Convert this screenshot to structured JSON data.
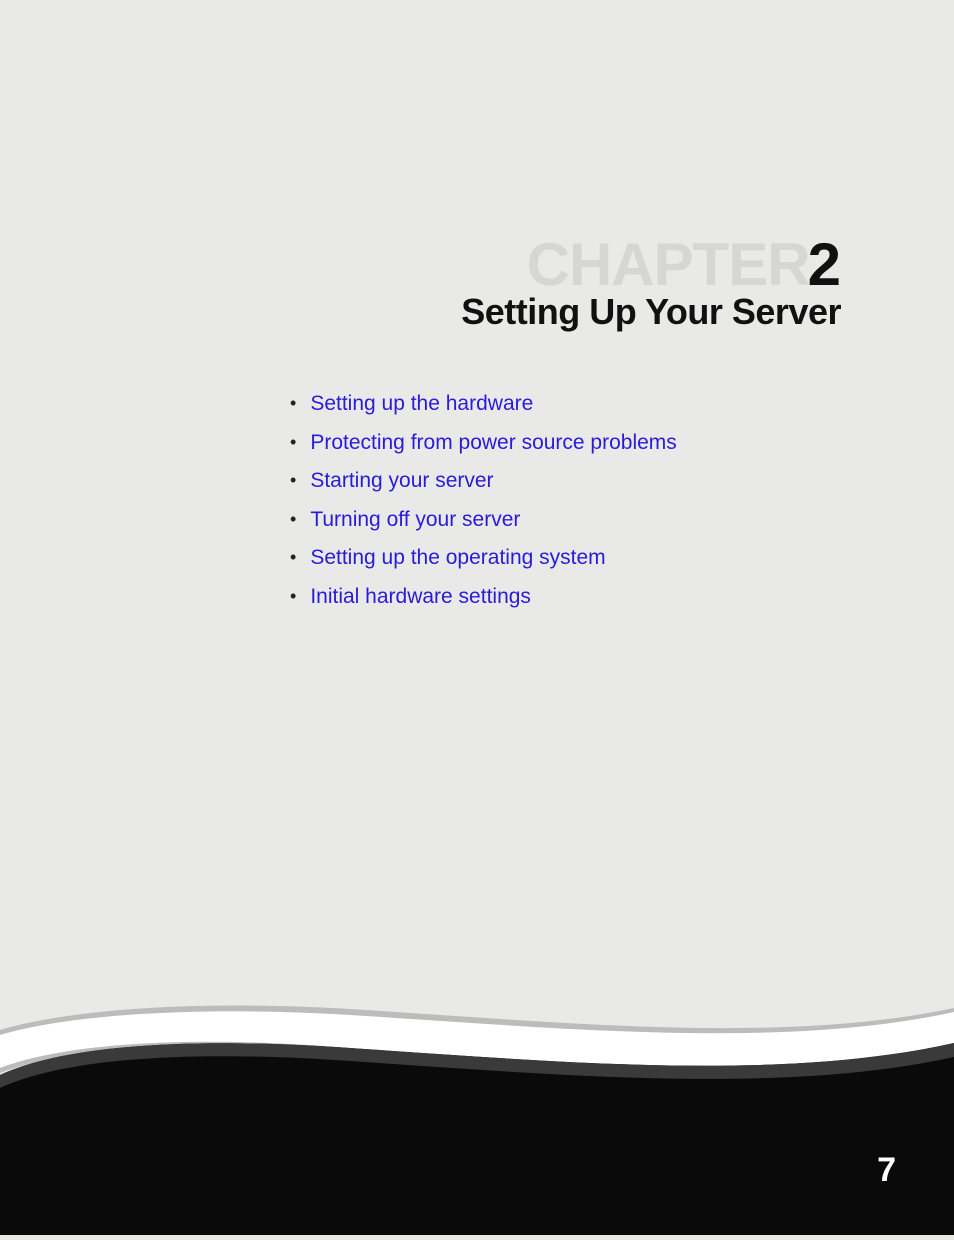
{
  "chapter": {
    "label": "CHAPTER",
    "number": "2",
    "title": "Setting Up Your Server"
  },
  "toc": {
    "items": [
      {
        "label": "Setting up the hardware"
      },
      {
        "label": "Protecting from power source problems"
      },
      {
        "label": "Starting your server"
      },
      {
        "label": "Turning off your server"
      },
      {
        "label": "Setting up the operating system"
      },
      {
        "label": "Initial hardware settings"
      }
    ]
  },
  "page_number": "7"
}
